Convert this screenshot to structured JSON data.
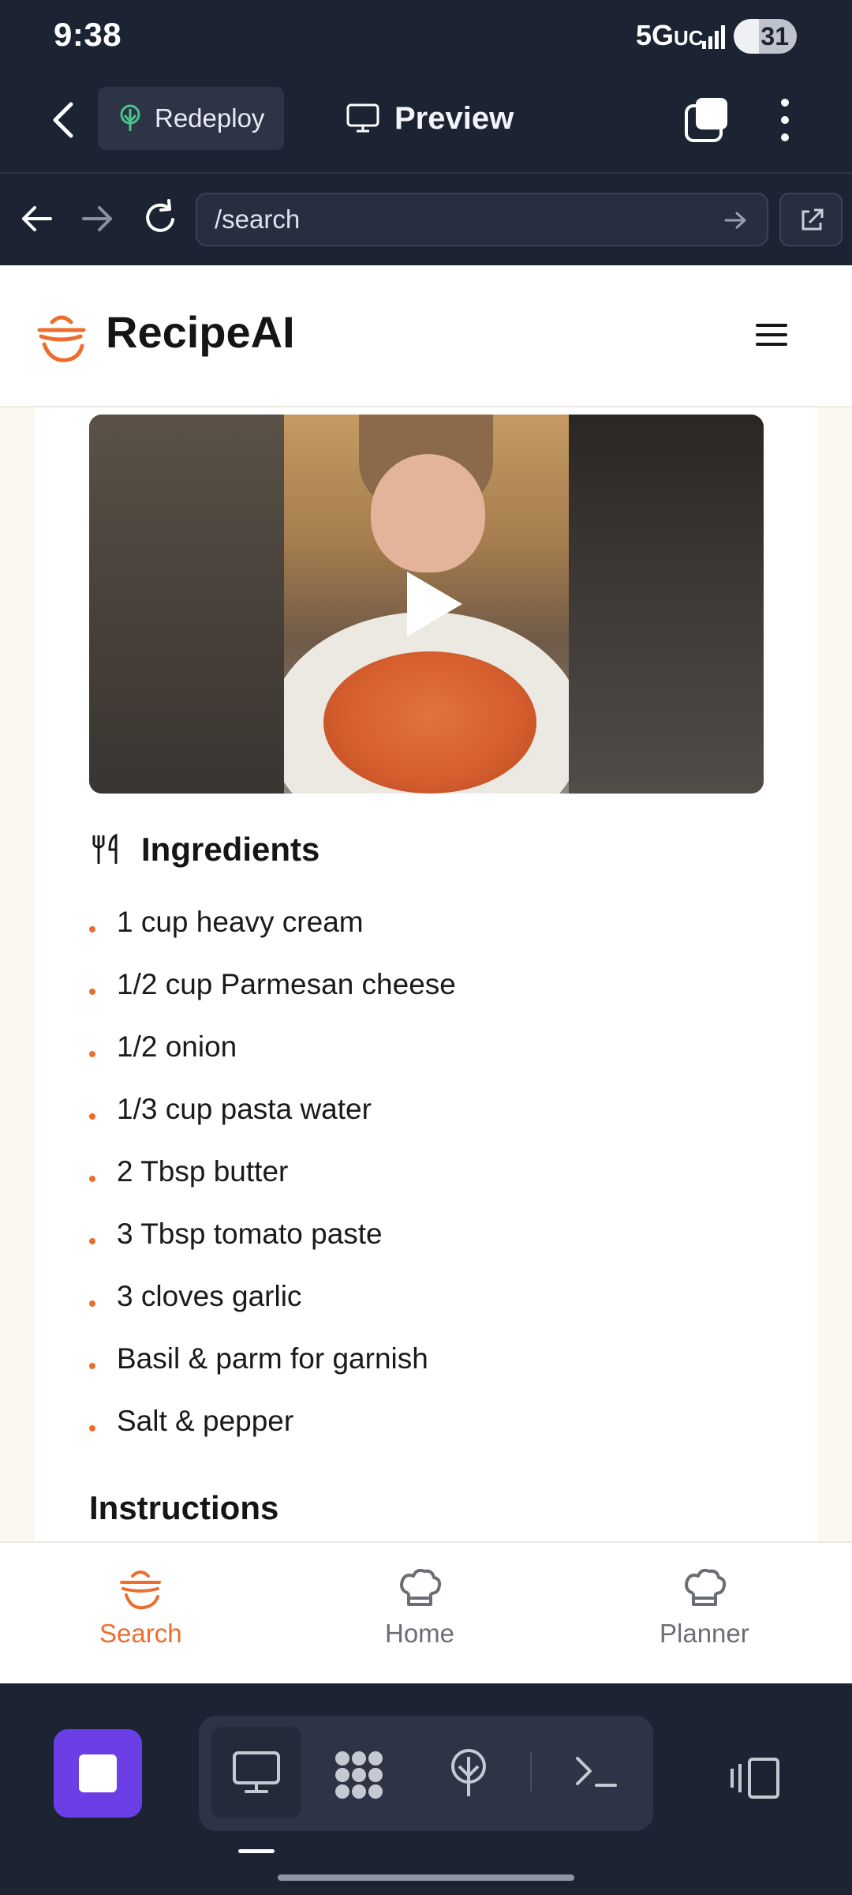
{
  "status_bar": {
    "time": "9:38",
    "network": "5G",
    "network_suffix": "UC",
    "battery": "31"
  },
  "top_toolbar": {
    "redeploy_label": "Redeploy",
    "preview_label": "Preview"
  },
  "url_bar": {
    "url": "/search"
  },
  "site": {
    "brand": "RecipeAI"
  },
  "recipe": {
    "ingredients_heading": "Ingredients",
    "ingredients": [
      "1 cup heavy cream",
      "1/2 cup Parmesan cheese",
      "1/2 onion",
      "1/3 cup pasta water",
      "2 Tbsp butter",
      "3 Tbsp tomato paste",
      "3 cloves garlic",
      "Basil & parm for garnish",
      "Salt & pepper"
    ],
    "instructions_heading": "Instructions"
  },
  "app_nav": {
    "items": [
      {
        "label": "Search",
        "icon": "bowl-icon",
        "active": true
      },
      {
        "label": "Home",
        "icon": "chef-hat-icon",
        "active": false
      },
      {
        "label": "Planner",
        "icon": "chef-hat-icon",
        "active": false
      }
    ]
  },
  "colors": {
    "accent": "#ec6e2e",
    "dark_chrome": "#1c2333",
    "stop_button": "#6b3ee6"
  }
}
